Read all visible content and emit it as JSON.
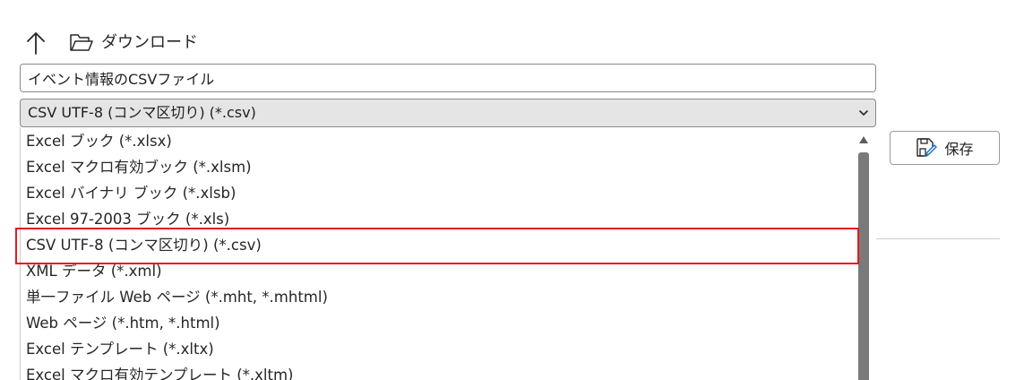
{
  "navigation": {
    "up_icon": "arrow-up-icon",
    "folder_icon": "folder-open-icon",
    "location": "ダウンロード"
  },
  "filename": {
    "value": "イベント情報のCSVファイル"
  },
  "file_type": {
    "selected": "CSV UTF-8 (コンマ区切り) (*.csv)",
    "options": [
      "Excel ブック (*.xlsx)",
      "Excel マクロ有効ブック (*.xlsm)",
      "Excel バイナリ ブック (*.xlsb)",
      "Excel 97-2003 ブック (*.xls)",
      "CSV UTF-8 (コンマ区切り) (*.csv)",
      "XML データ (*.xml)",
      "単一ファイル Web ページ (*.mht, *.mhtml)",
      "Web ページ (*.htm, *.html)",
      "Excel テンプレート (*.xltx)",
      "Excel マクロ有効テンプレート (*.xltm)"
    ],
    "highlighted_index": 4,
    "highlight_color": "#e8191a"
  },
  "actions": {
    "save_label": "保存",
    "save_icon": "save-pen-icon"
  }
}
